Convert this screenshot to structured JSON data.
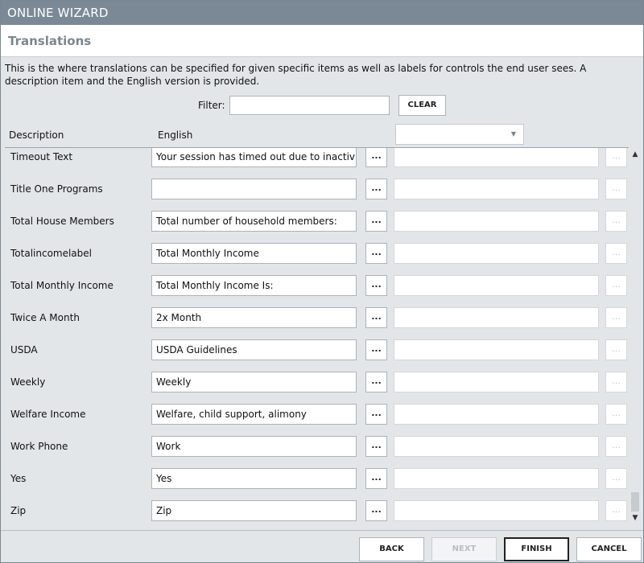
{
  "window": {
    "title": "ONLINE WIZARD"
  },
  "header": {
    "title": "Translations"
  },
  "intro": "This is the where translations can be specified for given specific items as well as labels for controls the end user sees. A description item and the English version is provided.",
  "filter": {
    "label": "Filter:",
    "value": "",
    "clear_label": "CLEAR"
  },
  "columns": {
    "description": "Description",
    "english": "English",
    "language_selected": ""
  },
  "rows": [
    {
      "description": "Timeout Text",
      "english": "Your session has timed out due to inactivity.<b",
      "translation": "",
      "more": "...",
      "more2": "..."
    },
    {
      "description": "Title One Programs",
      "english": "",
      "translation": "",
      "more": "...",
      "more2": "..."
    },
    {
      "description": "Total House Members",
      "english": "Total number of household members:",
      "translation": "",
      "more": "...",
      "more2": "..."
    },
    {
      "description": "Totalincomelabel",
      "english": "Total Monthly Income",
      "translation": "",
      "more": "...",
      "more2": "..."
    },
    {
      "description": "Total Monthly Income",
      "english": "Total Monthly Income Is:",
      "translation": "",
      "more": "...",
      "more2": "..."
    },
    {
      "description": "Twice A Month",
      "english": "2x Month",
      "translation": "",
      "more": "...",
      "more2": "..."
    },
    {
      "description": "USDA",
      "english": "USDA Guidelines",
      "translation": "",
      "more": "...",
      "more2": "..."
    },
    {
      "description": "Weekly",
      "english": "Weekly",
      "translation": "",
      "more": "...",
      "more2": "..."
    },
    {
      "description": "Welfare Income",
      "english": "Welfare, child support, alimony",
      "translation": "",
      "more": "...",
      "more2": "..."
    },
    {
      "description": "Work Phone",
      "english": "Work",
      "translation": "",
      "more": "...",
      "more2": "..."
    },
    {
      "description": "Yes",
      "english": "Yes",
      "translation": "",
      "more": "...",
      "more2": "..."
    },
    {
      "description": "Zip",
      "english": "Zip",
      "translation": "",
      "more": "...",
      "more2": "..."
    }
  ],
  "scrollbar": {
    "up_icon": "▲",
    "down_icon": "▼"
  },
  "footer": {
    "back": "BACK",
    "next": "NEXT",
    "finish": "FINISH",
    "cancel": "CANCEL"
  },
  "icons": {
    "dropdown": "chevron-down-icon",
    "scroll_up": "triangle-up-icon",
    "scroll_down": "triangle-down-icon"
  }
}
